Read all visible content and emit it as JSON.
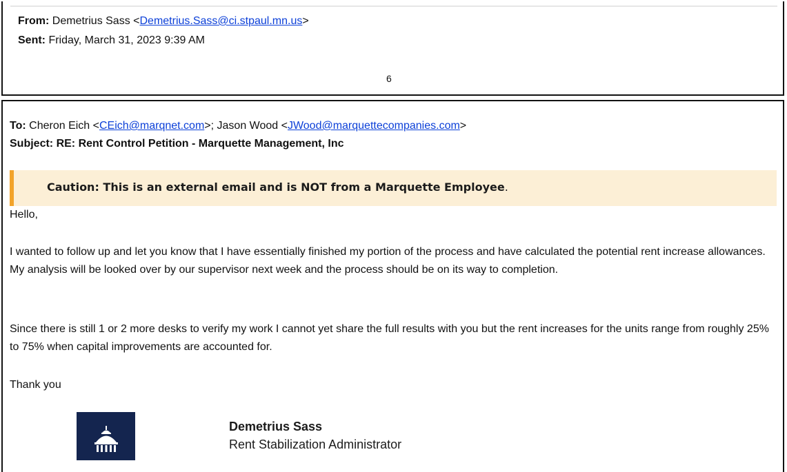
{
  "header": {
    "from_label": "From:",
    "from_name": "Demetrius Sass <",
    "from_email": "Demetrius.Sass@ci.stpaul.mn.us",
    "from_close": ">",
    "sent_label": "Sent:",
    "sent_value": "Friday, March 31, 2023 9:39 AM"
  },
  "page_number": "6",
  "recipients": {
    "to_label": "To:",
    "to_name_1": "Cheron Eich <",
    "to_email_1": "CEich@marqnet.com",
    "to_separator": ">; Jason Wood <",
    "to_email_2": "JWood@marquettecompanies.com",
    "to_close": ">",
    "subject_label": "Subject:",
    "subject_value": "RE: Rent Control Petition - Marquette Management, Inc"
  },
  "caution": {
    "text": "Caution: This is an external email and is NOT from a Marquette Employee",
    "suffix": "."
  },
  "body": {
    "greeting": "Hello,",
    "paragraph_1": "I wanted to follow up and let you know that I have essentially finished my portion of the process and have calculated the potential rent increase allowances. My analysis will be looked over by our supervisor next week and the process should be on its way to completion.",
    "paragraph_2": "Since there is still 1 or 2 more desks to verify my work I cannot yet share the full results with you but the rent increases for the units range from roughly 25% to 75% when capital improvements are accounted for.",
    "closing": "Thank you"
  },
  "signature": {
    "name": "Demetrius Sass",
    "title": "Rent Stabilization Administrator",
    "logo_icon": "capitol-dome-icon",
    "logo_color": "#14254f"
  },
  "colors": {
    "link": "#0b3fd8",
    "caution_bg": "#fcefd6",
    "caution_bar": "#f2a32a"
  }
}
